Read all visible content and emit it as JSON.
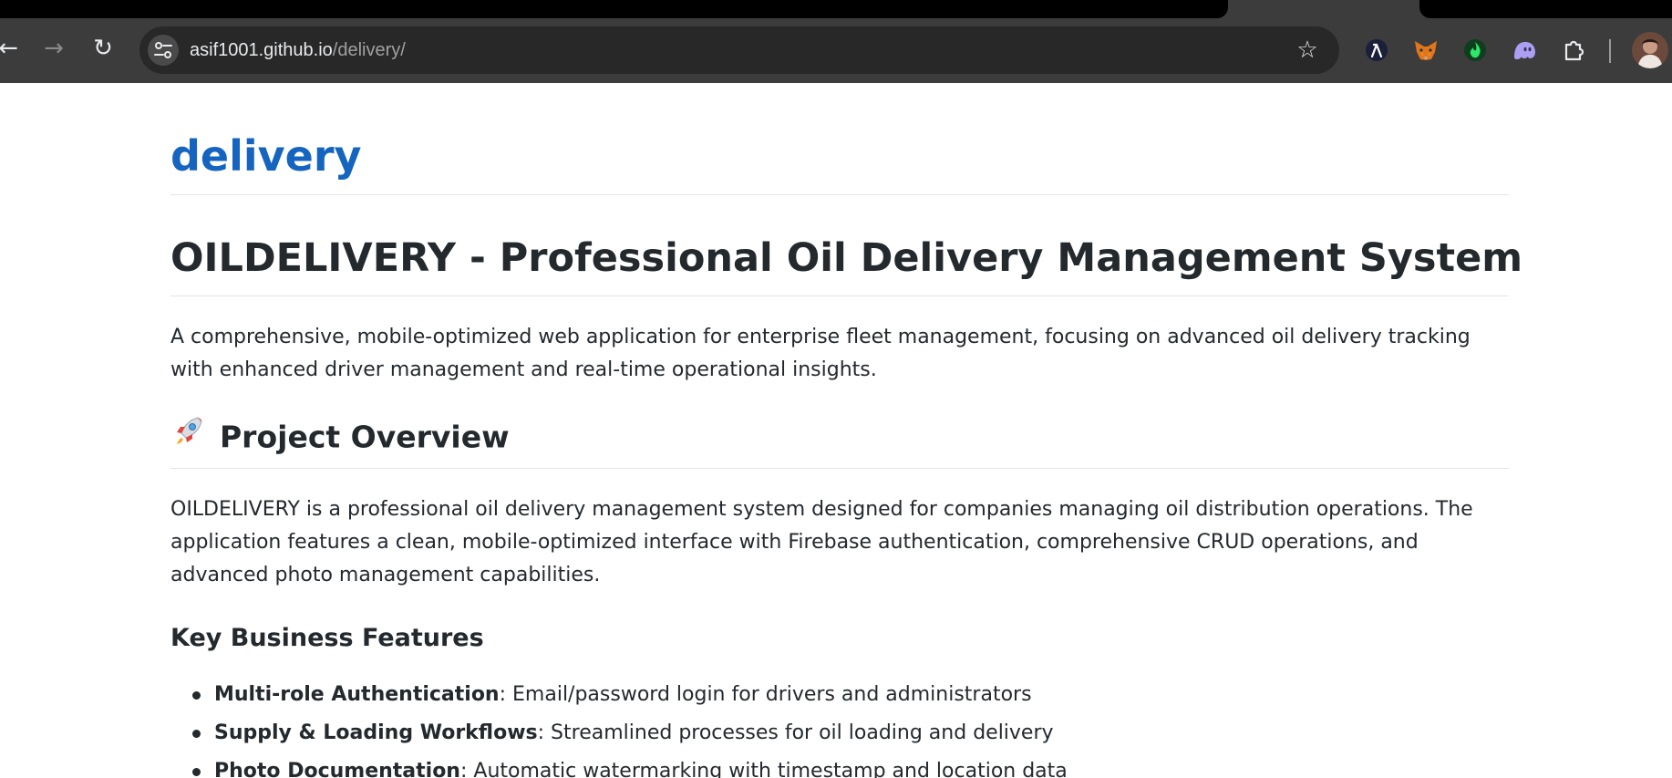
{
  "browser": {
    "url_host": "asif1001.github.io",
    "url_path": "/delivery/",
    "nav": {
      "back": "←",
      "forward": "→",
      "reload": "↻"
    },
    "bookmark_star": "☆",
    "extensions": [
      "lambda-extension-icon",
      "metamask-fox-icon",
      "green-flame-extension-icon",
      "ghost-extension-icon",
      "puzzle-extensions-icon"
    ]
  },
  "page": {
    "site_title": "delivery",
    "h1": "OILDELIVERY - Professional Oil Delivery Management System",
    "intro": "A comprehensive, mobile-optimized web application for enterprise fleet management, focusing on advanced oil delivery tracking with enhanced driver management and real-time operational insights.",
    "overview_heading": "Project Overview",
    "overview_text": "OILDELIVERY is a professional oil delivery management system designed for companies managing oil distribution operations. The application features a clean, mobile-optimized interface with Firebase authentication, comprehensive CRUD operations, and advanced photo management capabilities.",
    "features_heading": "Key Business Features",
    "features": [
      {
        "term": "Multi-role Authentication",
        "desc": ": Email/password login for drivers and administrators"
      },
      {
        "term": "Supply & Loading Workflows",
        "desc": ": Streamlined processes for oil loading and delivery"
      },
      {
        "term": "Photo Documentation",
        "desc": ": Automatic watermarking with timestamp and location data"
      }
    ]
  },
  "colors": {
    "chrome_bg": "#3c3c3c",
    "omnibox_bg": "#282828",
    "link_blue": "#1565c0",
    "text": "#24292e",
    "divider": "#e4e4e4"
  }
}
